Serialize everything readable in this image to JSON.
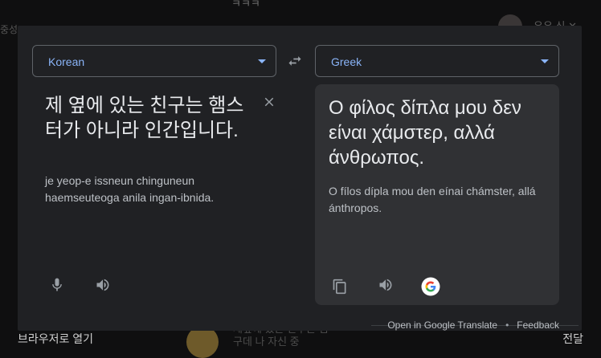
{
  "background": {
    "top_text": "ㅋㅋㅋ",
    "left_text": "중성",
    "right_top_text": "유유 신 ✕",
    "open_in_browser": "브라우저로 열기",
    "message_preview_line1": "제옆에 있는 친구는 햄",
    "message_preview_line2": "구데 나 자신 중",
    "forward": "전달"
  },
  "translator": {
    "source_language": "Korean",
    "target_language": "Greek",
    "source_text": "제 옆에 있는 친구는 햄스터가 아니라 인간입니다.",
    "source_romanization": "je yeop-e issneun chinguneun haemseuteoga anila ingan-ibnida.",
    "translation": "Ο φίλος δίπλα μου δεν είναι χάμστερ, αλλά άνθρωπος.",
    "translation_romanization": "O fílos dípla mou den eínai chámster, allá ánthropos.",
    "footer": {
      "open_link": "Open in Google Translate",
      "separator": "•",
      "feedback_link": "Feedback"
    }
  },
  "colors": {
    "accent": "#8ab4f8",
    "card_bg": "#202124",
    "panel_bg": "#303134"
  }
}
